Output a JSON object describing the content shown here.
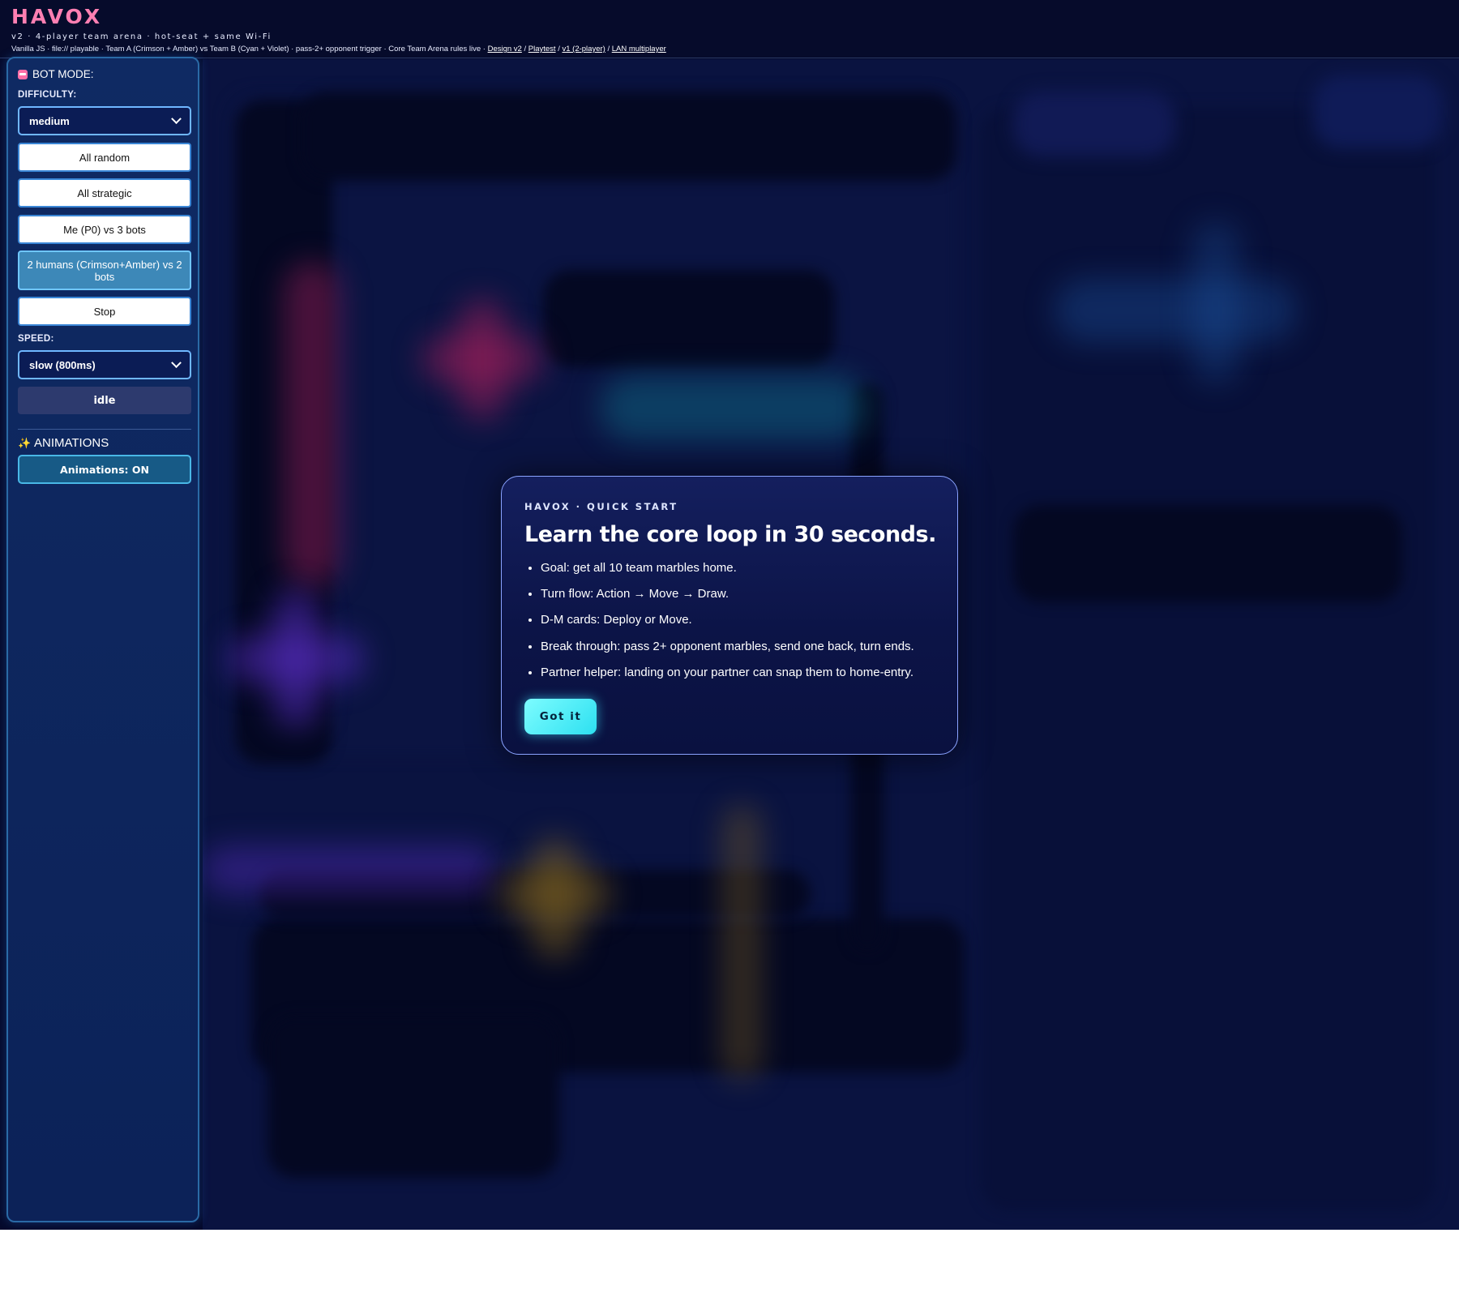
{
  "header": {
    "logo": "HAVOX",
    "subtitle": "v2 · 4-player team arena · hot-seat + same Wi-Fi",
    "meta_prefix": "Vanilla JS · file:// playable · Team A (Crimson + Amber) vs Team B (Cyan + Violet) · pass-2+ opponent trigger · Core Team Arena rules live · ",
    "links": [
      "Design v2",
      "Playtest",
      "v1 (2-player)",
      "LAN multiplayer"
    ],
    "link_separator": " / "
  },
  "sidebar": {
    "bot_mode_heading": "BOT MODE:",
    "bot_mode_icon": "robot-icon",
    "difficulty_label": "DIFFICULTY:",
    "difficulty_value": "medium",
    "buttons": [
      {
        "label": "All random",
        "active": false
      },
      {
        "label": "All strategic",
        "active": false
      },
      {
        "label": "Me (P0) vs 3 bots",
        "active": false
      },
      {
        "label": "2 humans (Crimson+Amber) vs 2 bots",
        "active": true
      },
      {
        "label": "Stop",
        "active": false
      }
    ],
    "speed_label": "SPEED:",
    "speed_value": "slow (800ms)",
    "status": "idle",
    "animations_heading": "ANIMATIONS",
    "animations_icon": "sparkles-icon",
    "animations_toggle": "Animations: ON"
  },
  "modal": {
    "eyebrow": "HAVOX · QUICK START",
    "title": "Learn the core loop in 30 seconds.",
    "items": [
      "Goal: get all 10 team marbles home.",
      "Turn flow: Action → Move → Draw.",
      "D-M cards: Deploy or Move.",
      "Break through: pass 2+ opponent marbles, send one back, turn ends.",
      "Partner helper: landing on your partner can snap them to home-entry."
    ],
    "button": "Got it"
  },
  "colors": {
    "background": "#050a2c",
    "logo": "#ff7fb2",
    "accent_cyan": "#2de0f0",
    "sidebar_border": "#2a6aa6",
    "crimson": "#b0205a",
    "violet": "#5a2ec8",
    "amber": "#8a6a20",
    "cyan": "#0f8a8a"
  }
}
